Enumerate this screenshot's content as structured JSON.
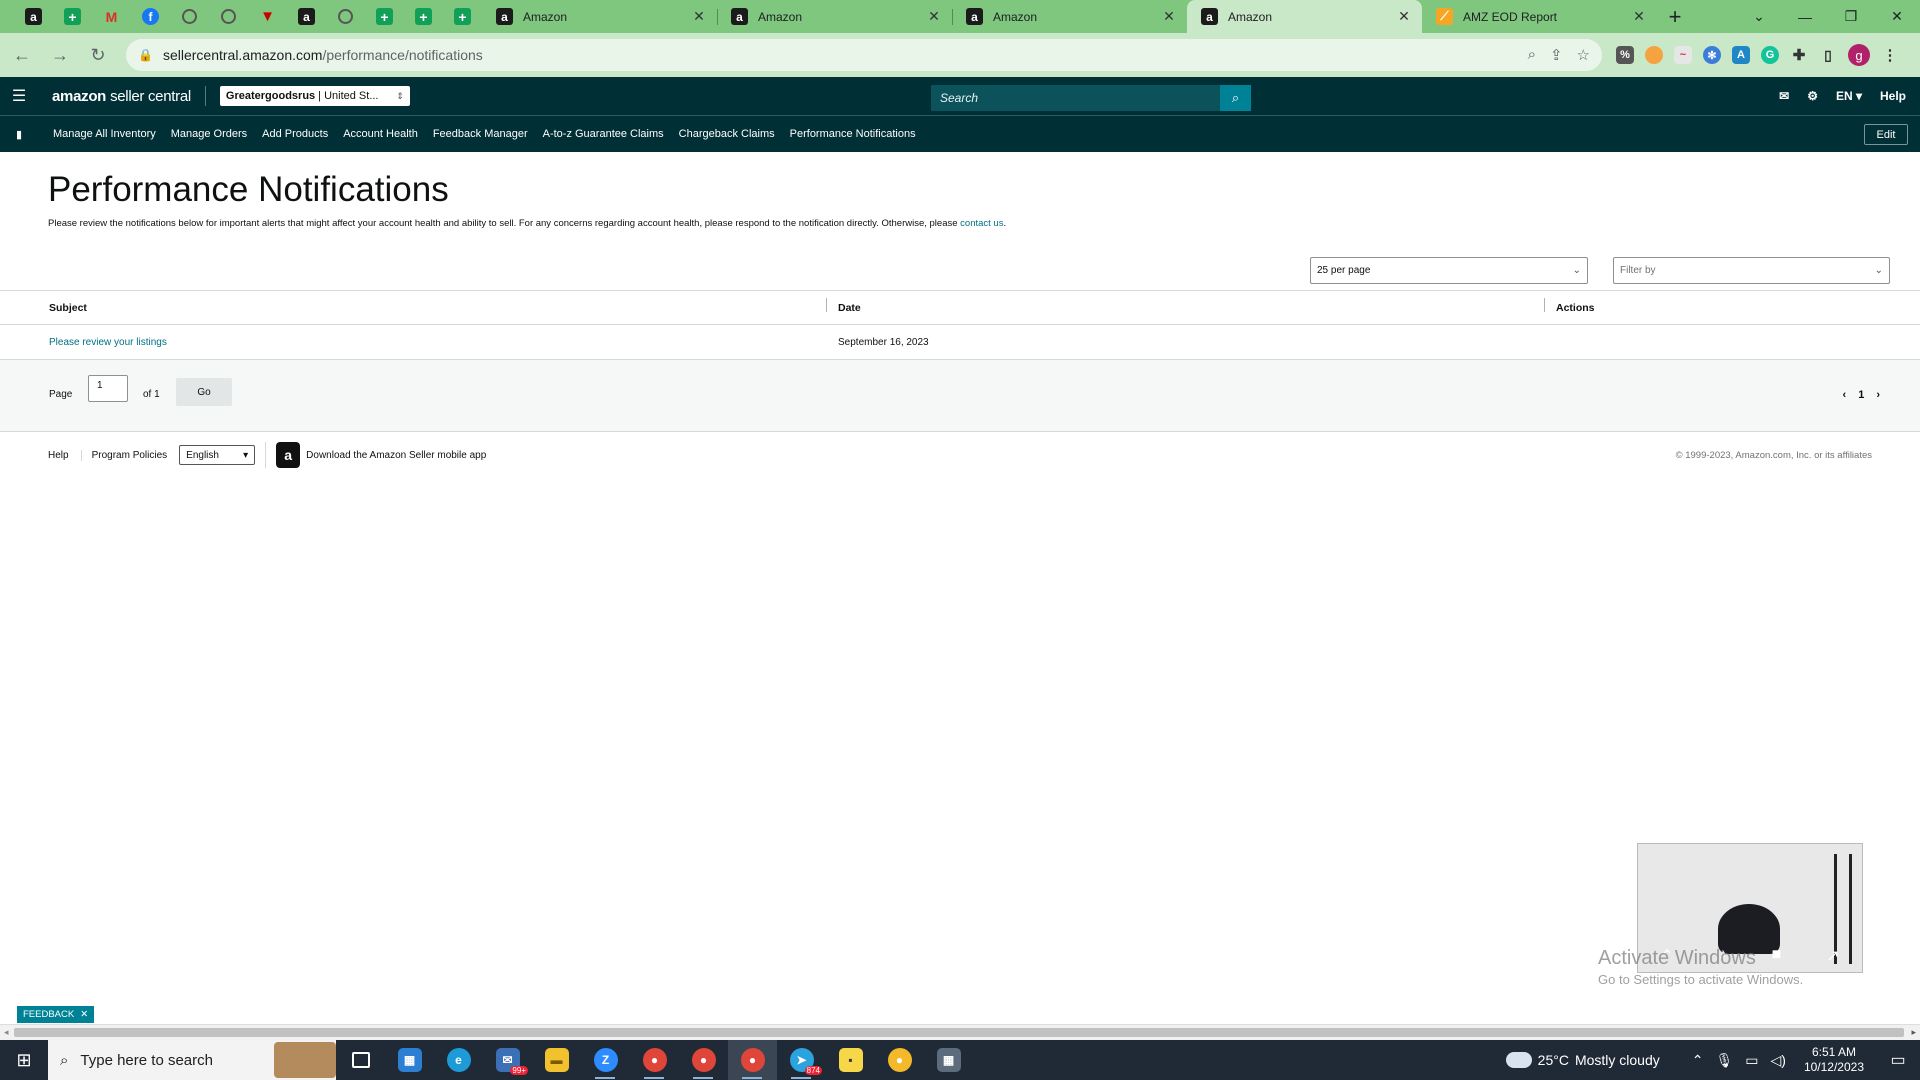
{
  "browser": {
    "pinned_tabs": [
      "amazon-icon",
      "sheets-icon",
      "gmail-icon",
      "facebook-icon",
      "globe-icon",
      "globe-icon",
      "flag-icon",
      "amazon-icon",
      "globe-icon",
      "sheets-icon",
      "sheets-icon",
      "sheets-icon"
    ],
    "tabs": [
      {
        "label": "Amazon",
        "icon": "amazon-icon",
        "active": false
      },
      {
        "label": "Amazon",
        "icon": "amazon-icon",
        "active": false
      },
      {
        "label": "Amazon",
        "icon": "amazon-icon",
        "active": false
      },
      {
        "label": "Amazon",
        "icon": "amazon-icon",
        "active": true
      },
      {
        "label": "AMZ EOD Report",
        "icon": "report-icon",
        "active": false
      }
    ],
    "url_host": "sellercentral.amazon.com",
    "url_path": "/performance/notifications",
    "profile_initial": "g",
    "accent_color": "#7fc67e"
  },
  "header": {
    "brand_amazon": "amazon",
    "brand_sc": "seller central",
    "store_name": "Greatergoodsrus",
    "store_region": "| United St...",
    "search_placeholder": "Search",
    "lang": "EN",
    "help": "Help",
    "bg_color": "#002f36"
  },
  "nav": {
    "items": [
      "Manage All Inventory",
      "Manage Orders",
      "Add Products",
      "Account Health",
      "Feedback Manager",
      "A-to-z Guarantee Claims",
      "Chargeback Claims",
      "Performance Notifications"
    ],
    "edit": "Edit"
  },
  "main": {
    "title": "Performance Notifications",
    "intro": "Please review the notifications below for important alerts that might affect your account health and ability to sell. For any concerns regarding account health, please respond to the notification directly. Otherwise, please ",
    "intro_link": "contact us",
    "intro_end": ".",
    "per_page": "25 per page",
    "filter_placeholder": "Filter by",
    "columns": [
      "Subject",
      "Date",
      "Actions"
    ],
    "rows": [
      {
        "subject": "Please review your listings",
        "date": "September 16, 2023",
        "actions": ""
      }
    ]
  },
  "pager": {
    "page_label": "Page",
    "page_value": "1",
    "of_label": "of 1",
    "go": "Go",
    "current": "1"
  },
  "footer": {
    "help": "Help",
    "policies": "Program Policies",
    "language": "English",
    "app_download": "Download the Amazon Seller mobile app",
    "copyright": "© 1999-2023, Amazon.com, Inc. or its affiliates"
  },
  "overlay": {
    "activate_title": "Activate Windows",
    "activate_sub": "Go to Settings to activate Windows.",
    "feedback": "FEEDBACK"
  },
  "taskbar": {
    "search_placeholder": "Type here to search",
    "mail_badge": "99+",
    "telegram_badge": "874",
    "weather_temp": "25°C",
    "weather_desc": "Mostly cloudy",
    "time": "6:51 AM",
    "date": "10/12/2023"
  }
}
